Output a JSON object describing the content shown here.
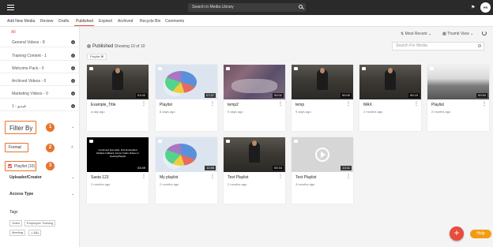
{
  "topbar": {
    "search_placeholder": "Search in Media Library",
    "avatar_initials": "PR"
  },
  "tabs": [
    "Add New Media",
    "Review",
    "Drafts",
    "Published",
    "Expired",
    "Archived",
    "Recycle Bin",
    "Comments"
  ],
  "active_tab": "Published",
  "sidebar": {
    "all_label": "All",
    "categories": [
      "General Videos - 8",
      "Training Content - 1",
      "Welcome Pack - 0",
      "Archived Videos - 0",
      "Marketing Videos - 0",
      "فيديو - 1"
    ],
    "filter_by": "Filter By",
    "format_label": "Format",
    "playlist_filter": "Playlist (10)",
    "uploader_label": "Uploader/Creator",
    "access_label": "Access Type",
    "tags_label": "Tags",
    "tags": [
      "Video",
      "Employee Training",
      "Meeting",
      "ملفات"
    ],
    "annotations": [
      "1",
      "2",
      "3"
    ]
  },
  "main": {
    "sort_label": "Most Recent",
    "view_label": "Thumb View",
    "published_label": "Published",
    "showing_text": "Showing 10 of 10",
    "search_placeholder": "Search For Media",
    "active_filter_chip": "Playlist ✖"
  },
  "cards": [
    {
      "title": "Example_Title",
      "sub": "a day ago",
      "duration": "01:02",
      "thumb": "office"
    },
    {
      "title": "Playlist",
      "sub": "8 days ago",
      "duration": "07:37",
      "thumb": "pie"
    },
    {
      "title": "temp2",
      "sub": "9 days ago",
      "duration": "00:01",
      "thumb": "team"
    },
    {
      "title": "temp",
      "sub": "9 days ago",
      "duration": "00:00",
      "thumb": "office"
    },
    {
      "title": "MAX",
      "sub": "2 months ago",
      "duration": "00:15",
      "thumb": "office"
    },
    {
      "title": "Playlist",
      "sub": "2 months ago",
      "duration": "00:54",
      "thumb": "openoffice"
    },
    {
      "title": "Sasta 123",
      "sub": "2 months ago",
      "duration": "03:49",
      "thumb": "black",
      "overlay": "Continued Era Hello: 2H1 Embedded Multiple Fallback Jumps Cabin Videos in Hosting/Playlist"
    },
    {
      "title": "My playlist",
      "sub": "2 months ago",
      "duration": "11:56",
      "thumb": "pie"
    },
    {
      "title": "Test Playlist",
      "sub": "2 months ago",
      "duration": "00:34",
      "thumb": "office"
    },
    {
      "title": "Test Playlist",
      "sub": "3 months ago",
      "duration": "13:11",
      "thumb": "gray"
    }
  ],
  "fab_label": "+",
  "help_label": "Help"
}
